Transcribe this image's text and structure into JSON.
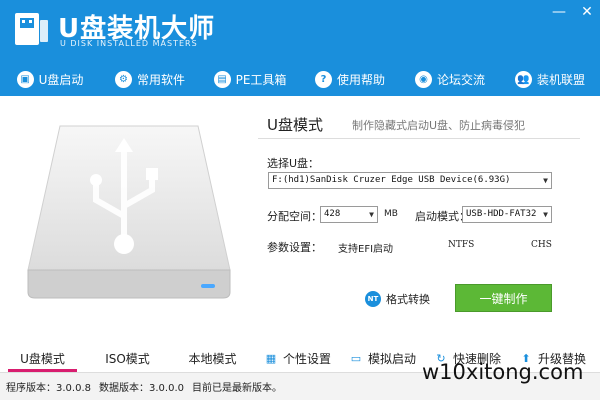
{
  "header": {
    "title": "U盘装机大师",
    "subtitle": "U DISK INSTALLED MASTERS",
    "window_controls": [
      "—",
      "✕"
    ]
  },
  "nav": [
    {
      "label": "U盘启动",
      "icon": "usb-drive-icon"
    },
    {
      "label": "常用软件",
      "icon": "gear-icon"
    },
    {
      "label": "PE工具箱",
      "icon": "toolbox-icon"
    },
    {
      "label": "使用帮助",
      "icon": "help-icon"
    },
    {
      "label": "论坛交流",
      "icon": "chat-icon"
    },
    {
      "label": "装机联盟",
      "icon": "users-icon"
    }
  ],
  "panel": {
    "mode_title": "U盘模式",
    "mode_desc": "制作隐藏式启动U盘、防止病毒侵犯",
    "select_usb_label": "选择U盘：",
    "usb_device": "F:(hd1)SanDisk Cruzer Edge USB Device(6.93G)",
    "alloc_label": "分配空间：",
    "alloc_value": "428",
    "alloc_unit": "MB",
    "boot_mode_label": "启动模式：",
    "boot_mode_value": "USB-HDD-FAT32",
    "params_label": "参数设置：",
    "param_efi": "支持EFI启动",
    "param_fs1": "NTFS",
    "param_fs2": "CHS",
    "convert_icon_text": "NT",
    "convert_label": "格式转换",
    "make_label": "一键制作"
  },
  "tabs": [
    {
      "label": "U盘模式",
      "active": true
    },
    {
      "label": "ISO模式",
      "active": false
    },
    {
      "label": "本地模式",
      "active": false
    },
    {
      "label": "个性设置",
      "icon": "grid-icon",
      "active": false
    },
    {
      "label": "模拟启动",
      "icon": "monitor-icon",
      "active": false
    },
    {
      "label": "快速删除",
      "icon": "refresh-icon",
      "active": false
    },
    {
      "label": "升级替换",
      "icon": "upgrade-icon",
      "active": false
    }
  ],
  "status": {
    "program_version": "程序版本：3.0.0.8",
    "data_version": "数据版本：3.0.0.0",
    "update_msg": "目前已是最新版本。"
  },
  "watermark": "w10xitong.com",
  "colors": {
    "header_bg": "#1a8fdc",
    "make_button": "#5cb836",
    "active_tab_underline": "#d81d6f"
  }
}
